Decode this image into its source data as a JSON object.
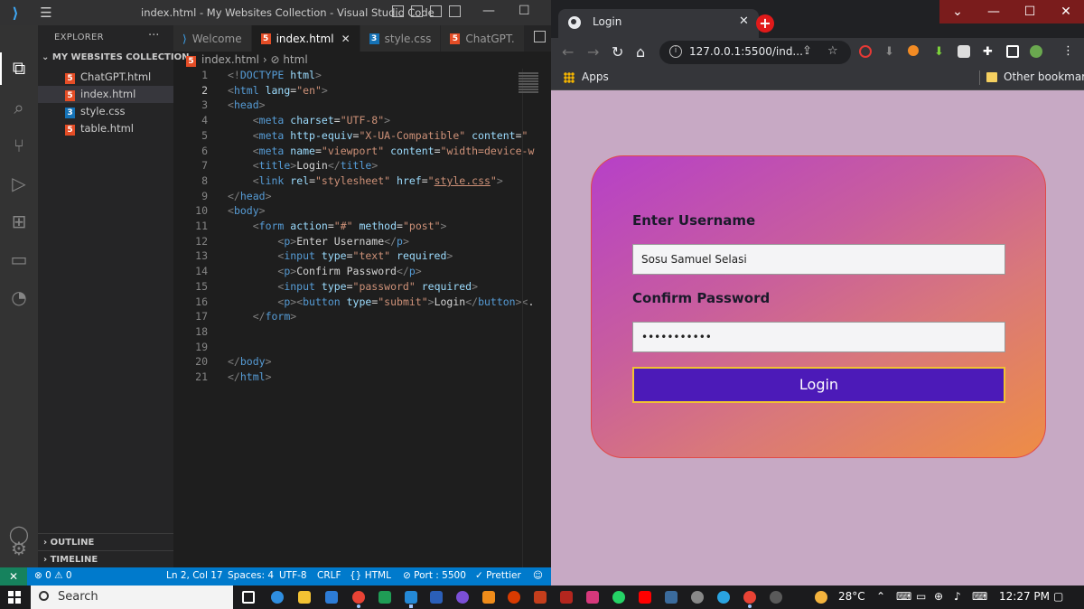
{
  "vscode": {
    "window_title": "index.html - My Websites Collection - Visual Studio Code",
    "explorer_label": "EXPLORER",
    "folder_name": "MY WEBSITES COLLECTION",
    "files": [
      {
        "name": "ChatGPT.html",
        "type": "html"
      },
      {
        "name": "index.html",
        "type": "html"
      },
      {
        "name": "style.css",
        "type": "css"
      },
      {
        "name": "table.html",
        "type": "html"
      }
    ],
    "outline_label": "OUTLINE",
    "timeline_label": "TIMELINE",
    "tabs": [
      "Welcome",
      "index.html",
      "style.css",
      "ChatGPT."
    ],
    "breadcrumb_file": "index.html",
    "breadcrumb_node": "html",
    "line_numbers": [
      "1",
      "2",
      "3",
      "4",
      "5",
      "6",
      "7",
      "8",
      "9",
      "10",
      "11",
      "12",
      "13",
      "14",
      "15",
      "16",
      "17",
      "18",
      "19",
      "20",
      "21"
    ],
    "status": {
      "problems": "⊗ 0 ⚠ 0",
      "position": "Ln 2, Col 17",
      "spaces": "Spaces: 4",
      "encoding": "UTF-8",
      "eol": "CRLF",
      "language": "{} HTML",
      "port": "⊘ Port : 5500",
      "prettier": "✓ Prettier"
    }
  },
  "browser": {
    "tab_title": "Login",
    "url": "127.0.0.1:5500/ind...",
    "bookmarks": {
      "apps": "Apps",
      "other": "Other bookmarks"
    },
    "page": {
      "username_label": "Enter Username",
      "username_value": "Sosu Samuel Selasi",
      "password_label": "Confirm Password",
      "password_mask": "•••••••••••",
      "login_button": "Login"
    }
  },
  "taskbar": {
    "search_label": "Search",
    "temperature": "28°C",
    "time": "12:27 PM"
  }
}
